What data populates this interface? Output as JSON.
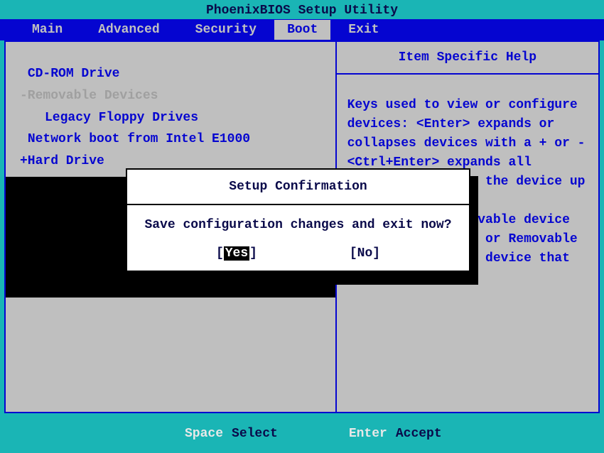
{
  "title": "PhoenixBIOS Setup Utility",
  "menu": {
    "items": [
      "Main",
      "Advanced",
      "Security",
      "Boot",
      "Exit"
    ],
    "active_index": 3
  },
  "boot_list": {
    "items": [
      {
        "label": "CD-ROM Drive",
        "selected": false,
        "indented": false,
        "prefix": " "
      },
      {
        "label": "-Removable Devices",
        "selected": true,
        "indented": false,
        "prefix": ""
      },
      {
        "label": "Legacy Floppy Drives",
        "selected": false,
        "indented": true,
        "prefix": ""
      },
      {
        "label": "Network boot from Intel E1000",
        "selected": false,
        "indented": false,
        "prefix": " "
      },
      {
        "label": "+Hard Drive",
        "selected": false,
        "indented": false,
        "prefix": ""
      }
    ]
  },
  "help": {
    "title": "Item Specific Help",
    "content": "Keys used to view or configure devices:\n<Enter> expands or collapses devices with a + or -\n<Ctrl+Enter> expands all\n<+> and <-> moves the device up or down.\n<n> May move removable device between Hard Disk or Removable Disk\n<d> Remove a device that is not installed."
  },
  "dialog": {
    "title": "Setup Confirmation",
    "message": "Save configuration changes and exit now?",
    "yes_left": "[",
    "yes_text": "Yes",
    "yes_right": "]",
    "no": "[No]"
  },
  "footer": {
    "key1": "Space",
    "label1": "Select",
    "key2": "Enter",
    "label2": "Accept"
  }
}
